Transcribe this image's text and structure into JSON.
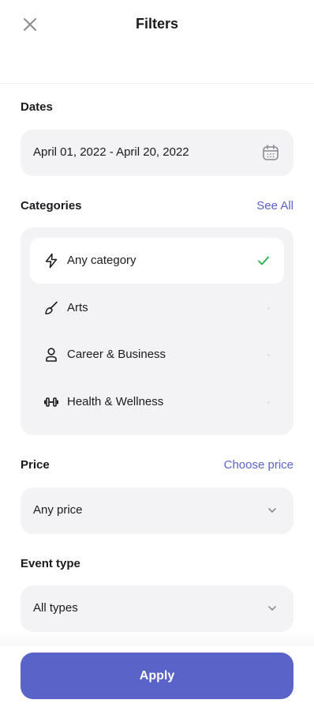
{
  "header": {
    "title": "Filters",
    "close_icon": "close-icon"
  },
  "dates": {
    "label": "Dates",
    "value": "April 01, 2022 - April 20, 2022",
    "icon": "calendar-icon"
  },
  "categories": {
    "label": "Categories",
    "see_all": "See All",
    "items": [
      {
        "label": "Any category",
        "icon": "lightning-icon",
        "selected": true
      },
      {
        "label": "Arts",
        "icon": "brush-icon",
        "selected": false
      },
      {
        "label": "Career & Business",
        "icon": "person-icon",
        "selected": false
      },
      {
        "label": "Health & Wellness",
        "icon": "dumbbell-icon",
        "selected": false
      }
    ]
  },
  "price": {
    "label": "Price",
    "link": "Choose price",
    "value": "Any price"
  },
  "event_type": {
    "label": "Event type",
    "value": "All types"
  },
  "apply_button": {
    "label": "Apply"
  },
  "colors": {
    "accent": "#5a63c8",
    "check": "#22b14c",
    "field_bg": "#f3f3f5"
  }
}
